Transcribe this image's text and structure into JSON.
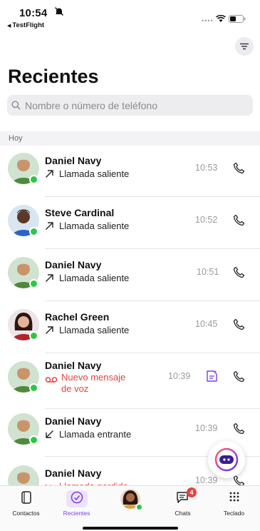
{
  "status": {
    "time": "10:54",
    "back_app": "TestFlight"
  },
  "header": {
    "title": "Recientes"
  },
  "search": {
    "placeholder": "Nombre o número de teléfono"
  },
  "section": {
    "label": "Hoy"
  },
  "calls": [
    {
      "name": "Daniel Navy",
      "type": "Llamada saliente",
      "direction": "outgoing",
      "time": "10:53"
    },
    {
      "name": "Steve Cardinal",
      "type": "Llamada saliente",
      "direction": "outgoing",
      "time": "10:52"
    },
    {
      "name": "Daniel Navy",
      "type": "Llamada saliente",
      "direction": "outgoing",
      "time": "10:51"
    },
    {
      "name": "Rachel Green",
      "type": "Llamada saliente",
      "direction": "outgoing",
      "time": "10:45"
    },
    {
      "name": "Daniel Navy",
      "type_line1": "Nuevo mensaje",
      "type_line2": "de voz",
      "direction": "voicemail",
      "time": "10:39"
    },
    {
      "name": "Daniel Navy",
      "type": "Llamada entrante",
      "direction": "incoming",
      "time": "10:39"
    },
    {
      "name": "Daniel Navy",
      "type": "Llamada perdida",
      "direction": "missed",
      "time": "10:39"
    }
  ],
  "tabbar": {
    "contacts": "Contactos",
    "recents": "Recientes",
    "chats": "Chats",
    "chats_badge": "4",
    "keypad": "Teclado"
  },
  "colors": {
    "accent": "#7b3fe4",
    "missed": "#e5433f",
    "presence": "#2fc54a"
  }
}
